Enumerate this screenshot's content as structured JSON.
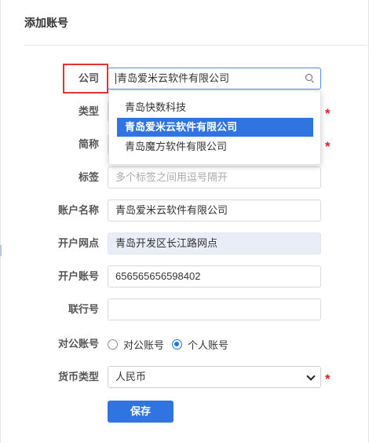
{
  "dialog": {
    "title": "添加账号"
  },
  "form": {
    "company": {
      "label": "公司",
      "value": "青岛爱米云软件有限公司"
    },
    "type": {
      "label": "类型"
    },
    "short_name": {
      "label": "简称"
    },
    "tags": {
      "label": "标签",
      "placeholder": "多个标签之间用逗号隔开"
    },
    "account_name": {
      "label": "账户名称",
      "value": "青岛爱米云软件有限公司"
    },
    "branch": {
      "label": "开户网点",
      "value": "青岛开发区长江路网点"
    },
    "account_number": {
      "label": "开户账号",
      "value": "656565656598402"
    },
    "bank_code": {
      "label": "联行号",
      "value": ""
    },
    "account_kind": {
      "label": "对公账号",
      "options": [
        "对公账号",
        "个人账号"
      ],
      "selected": "个人账号"
    },
    "currency": {
      "label": "货币类型",
      "value": "人民币"
    },
    "required_mark": "*"
  },
  "company_dropdown": {
    "options": [
      "青岛快数科技",
      "青岛爱米云软件有限公司",
      "青岛魔方软件有限公司"
    ],
    "selected_index": 1
  },
  "actions": {
    "save_label": "保存"
  },
  "colors": {
    "accent": "#2f74e0",
    "required": "#e02020",
    "highlight": "#e53232"
  }
}
